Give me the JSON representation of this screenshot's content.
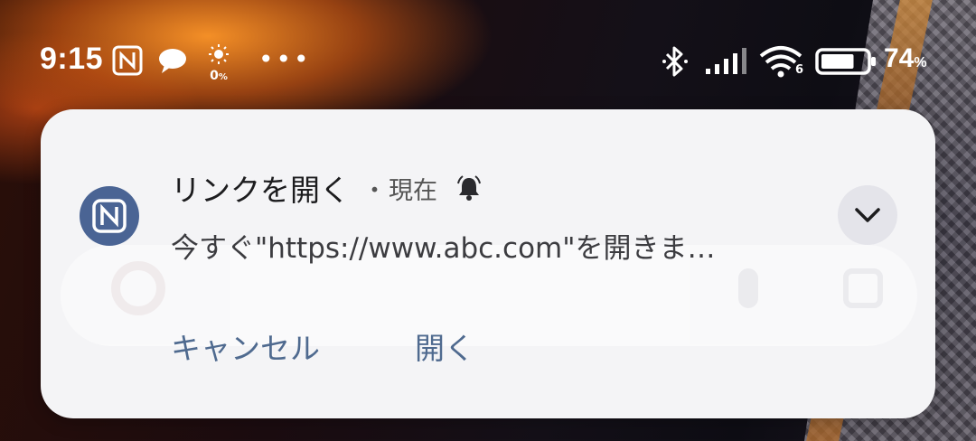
{
  "status_bar": {
    "time": "9:15",
    "sun_value": "0",
    "sun_unit": "%",
    "overflow_dots": "•••",
    "wifi_badge": "6",
    "battery_level": 74,
    "battery_value": "74",
    "battery_unit": "%",
    "icons": [
      "nfc-icon",
      "message-bubble-icon",
      "brightness-icon",
      "more-dots-icon",
      "bluetooth-icon",
      "signal-icon",
      "wifi-icon",
      "battery-icon"
    ]
  },
  "notification": {
    "app_icon": "nfc-icon",
    "title": "リンクを開く",
    "separator": "・",
    "time": "現在",
    "alert_icon": "bell-icon",
    "body": "今すぐ\"https://www.abc.com\"を開きま…",
    "expand_icon": "chevron-down-icon",
    "actions": {
      "cancel": "キャンセル",
      "open": "開く"
    }
  },
  "colors": {
    "card_bg": "#f4f4f6",
    "action_text": "#4f6a8f",
    "app_icon_bg": "#4a6494"
  }
}
